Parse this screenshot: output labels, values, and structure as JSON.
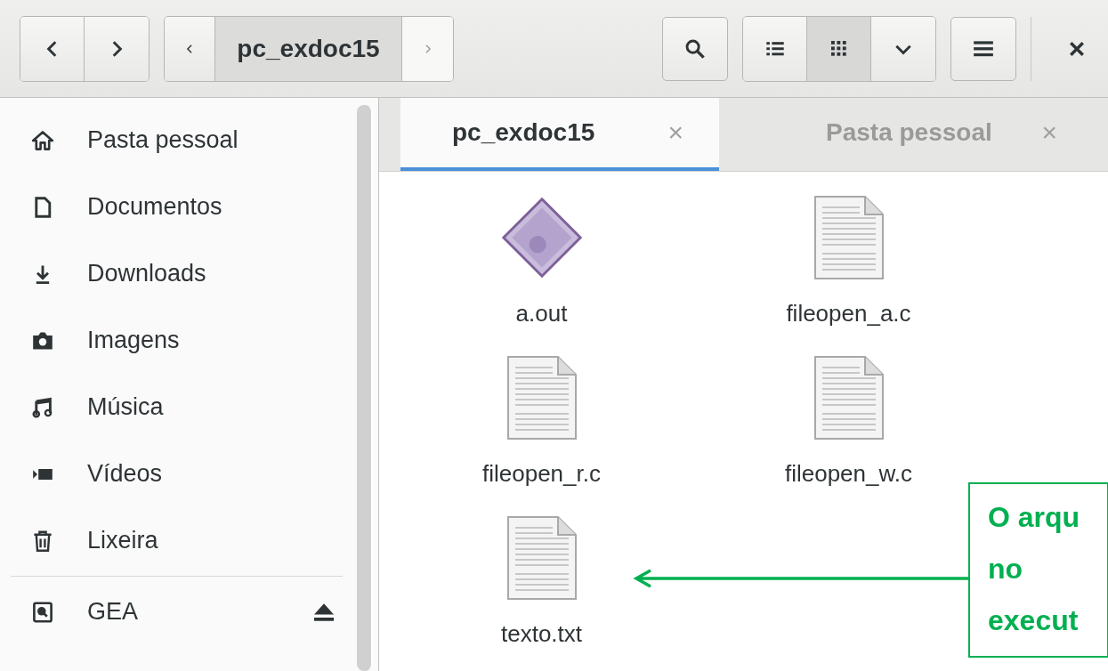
{
  "toolbar": {
    "path_label": "pc_exdoc15",
    "view_modes": [
      {
        "kind": "list",
        "selected": false
      },
      {
        "kind": "grid",
        "selected": true
      }
    ]
  },
  "sidebar": {
    "items": [
      {
        "label": "Pasta pessoal",
        "kind": "home",
        "eject": false
      },
      {
        "label": "Documentos",
        "kind": "document",
        "eject": false
      },
      {
        "label": "Downloads",
        "kind": "download",
        "eject": false
      },
      {
        "label": "Imagens",
        "kind": "camera",
        "eject": false
      },
      {
        "label": "Música",
        "kind": "music",
        "eject": false
      },
      {
        "label": "Vídeos",
        "kind": "video",
        "eject": false
      },
      {
        "label": "Lixeira",
        "kind": "trash",
        "eject": false
      },
      {
        "label": "GEA",
        "kind": "drive",
        "eject": true
      }
    ]
  },
  "tabs": [
    {
      "label": "pc_exdoc15",
      "close": "×",
      "selected": true
    },
    {
      "label": "Pasta pessoal",
      "close": "×",
      "selected": false
    }
  ],
  "files": [
    {
      "name": "a.out",
      "kind": "executable"
    },
    {
      "name": "fileopen_a.c",
      "kind": "text"
    },
    {
      "name": "fileopen_r.c",
      "kind": "text"
    },
    {
      "name": "fileopen_w.c",
      "kind": "text"
    },
    {
      "name": "texto.txt",
      "kind": "text"
    }
  ],
  "callout": {
    "lines": [
      "O arqu",
      "no",
      "execut"
    ]
  }
}
